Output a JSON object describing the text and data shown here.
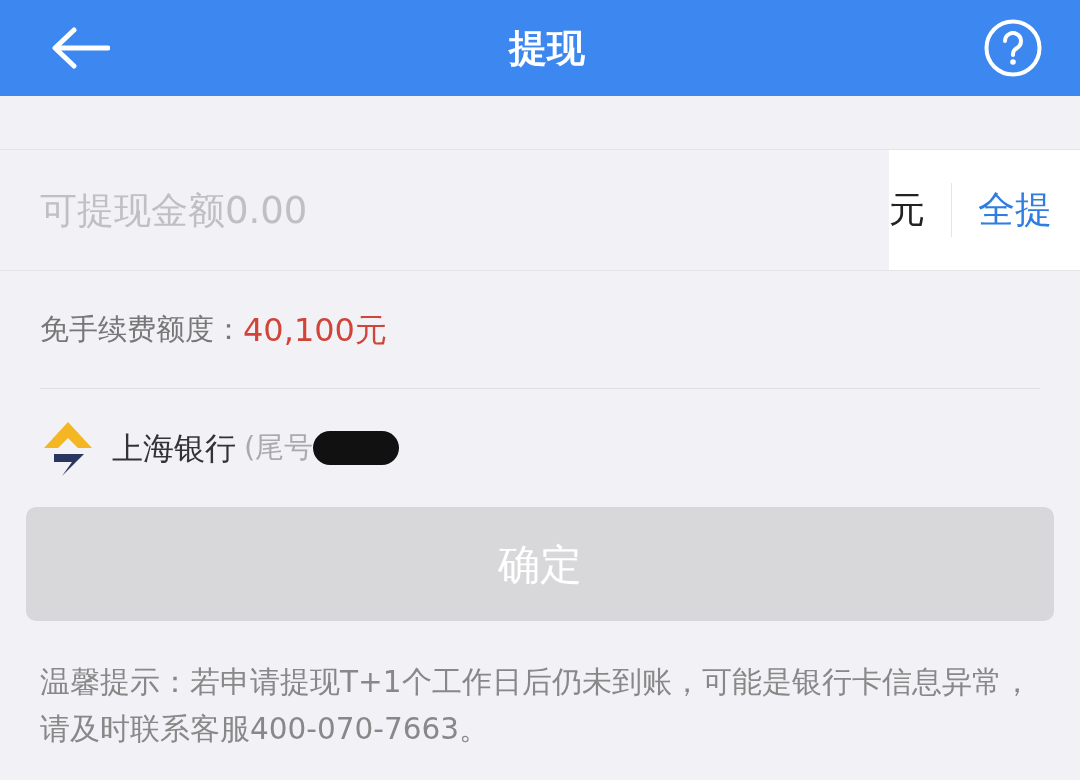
{
  "header": {
    "title": "提现"
  },
  "amount": {
    "placeholder": "可提现金额0.00",
    "unit": "元",
    "action": "全提"
  },
  "fee_free": {
    "label": "免手续费额度：",
    "value": "40,100元"
  },
  "bank": {
    "name": "上海银行",
    "tail": "(尾号"
  },
  "confirm": {
    "label": "确定",
    "disabled": true
  },
  "tip": "温馨提示：若申请提现T+1个工作日后仍未到账，可能是银行卡信息异常，请及时联系客服400-070-7663。"
}
